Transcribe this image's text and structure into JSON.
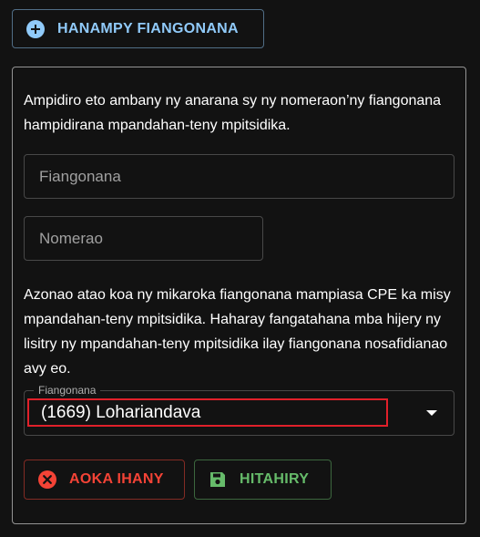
{
  "add_button": {
    "label": "HANAMPY FIANGONANA",
    "icon": "plus-circle-icon",
    "color": "#90caf9"
  },
  "form": {
    "intro": "Ampidiro eto ambany ny anarana sy ny nomeraon’ny fiangonana hampidirana mpandahan-teny mpitsidika.",
    "church_field": {
      "value": "",
      "placeholder": "Fiangonana"
    },
    "number_field": {
      "value": "",
      "placeholder": "Nomerao"
    },
    "info": "Azonao atao koa ny mikaroka fiangonana mampiasa CPE ka misy mpandahan-teny mpitsidika. Haharay fangatahana mba hijery ny lisitry ny mpandahan-teny mpitsidika ilay fiangonana nosafidianao avy eo.",
    "select": {
      "label": "Fiangonana",
      "selected": "(1669) Lohariandava",
      "icon": "dropdown-arrow-icon"
    },
    "cancel_button": {
      "label": "AOKA IHANY",
      "icon": "cancel-circle-icon",
      "color": "#f44336"
    },
    "save_button": {
      "label": "HITAHIRY",
      "icon": "save-icon",
      "color": "#66bb6a"
    }
  }
}
